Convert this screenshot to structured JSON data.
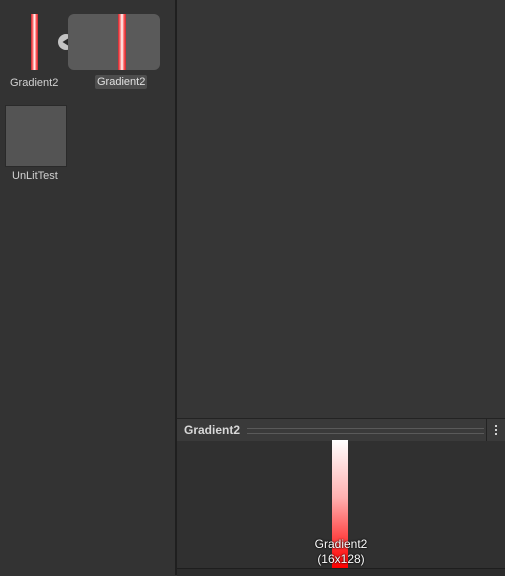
{
  "project_browser": {
    "assets": [
      {
        "label": "Gradient2",
        "type": "texture"
      },
      {
        "label": "Gradient2",
        "type": "sprite",
        "selected": true
      },
      {
        "label": "UnLitTest",
        "type": "material"
      }
    ],
    "expand_icon": "triangle-left-icon"
  },
  "preview": {
    "title": "Gradient2",
    "caption_name": "Gradient2",
    "caption_size": "(16x128)",
    "menu_icon": "kebab-menu-icon"
  },
  "colors": {
    "gradient_red": "#ff0000",
    "gradient_white": "#ffffff",
    "panel_bg": "#333333"
  }
}
